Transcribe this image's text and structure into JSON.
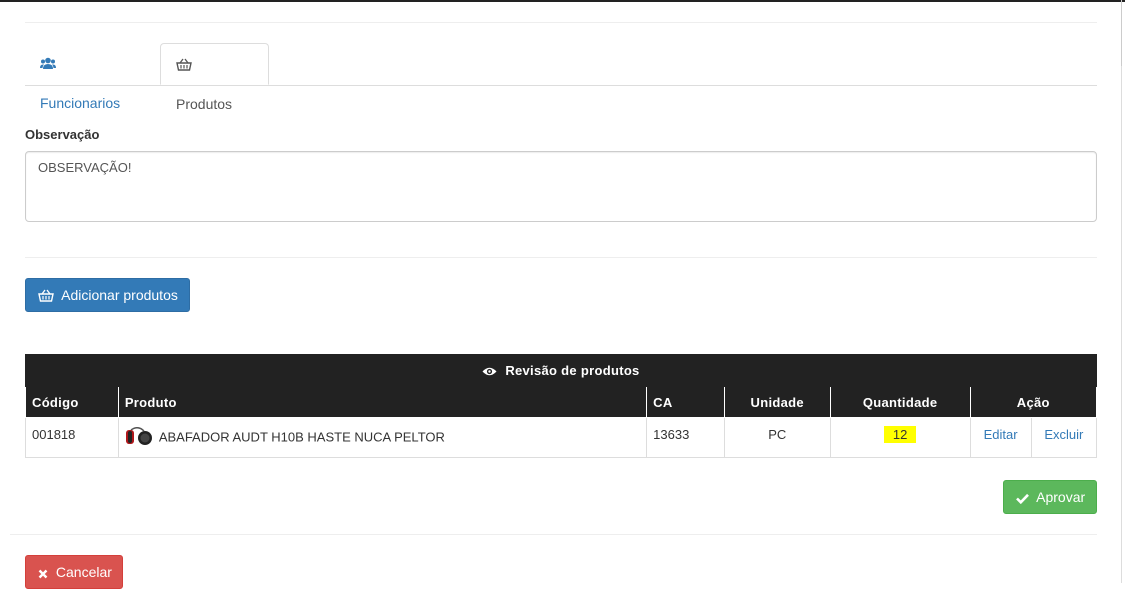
{
  "tabs": [
    {
      "label": "Funcionarios",
      "icon": "users-icon"
    },
    {
      "label": "Produtos",
      "icon": "basket-icon",
      "active": true
    }
  ],
  "observacao": {
    "label": "Observação",
    "value": "OBSERVAÇÃO!"
  },
  "buttons": {
    "add_products": "Adicionar produtos",
    "approve": "Aprovar",
    "cancel": "Cancelar"
  },
  "review_table": {
    "title": "Revisão de produtos",
    "columns": [
      "Código",
      "Produto",
      "CA",
      "Unidade",
      "Quantidade",
      "Ação"
    ],
    "rows": [
      {
        "codigo": "001818",
        "produto": "ABAFADOR AUDT H10B HASTE NUCA PELTOR",
        "ca": "13633",
        "unidade": "PC",
        "quantidade": "12",
        "edit_label": "Editar",
        "delete_label": "Excluir"
      }
    ]
  },
  "colors": {
    "primary": "#337ab7",
    "success": "#5cb85c",
    "danger": "#d9534f",
    "table_header": "#222222",
    "highlight": "#ffff00"
  }
}
